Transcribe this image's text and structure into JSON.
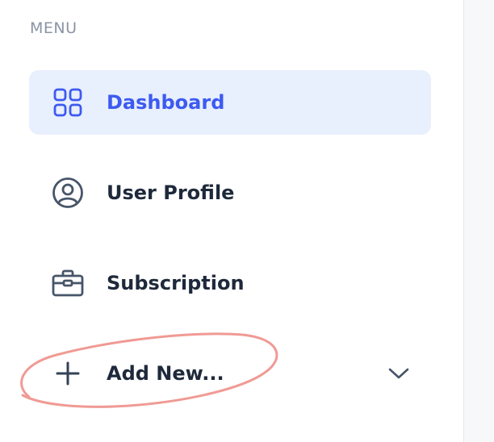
{
  "sidebar": {
    "section_label": "MENU",
    "items": [
      {
        "label": "Dashboard",
        "icon": "grid-icon",
        "active": true
      },
      {
        "label": "User Profile",
        "icon": "user-circle-icon",
        "active": false
      },
      {
        "label": "Subscription",
        "icon": "briefcase-icon",
        "active": false
      },
      {
        "label": "Add New...",
        "icon": "plus-icon",
        "active": false,
        "expandable": true
      }
    ]
  },
  "colors": {
    "accent": "#3d5af1",
    "active_bg": "#e8effd",
    "text": "#1e293b",
    "muted": "#8a94a6",
    "annotation": "#f09a94"
  }
}
